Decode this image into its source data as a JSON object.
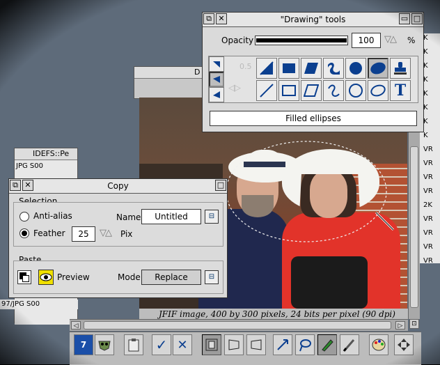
{
  "background": {
    "window_title": "IDEFS::Pe",
    "window_title_short": "D",
    "file_rows": [
      "JPG     S00",
      "",
      "",
      "",
      "",
      "97/JPG    S00"
    ],
    "file_codes_right": [
      "K",
      "K",
      "K",
      "K",
      "K",
      "K",
      "K",
      "K",
      "VR",
      "VR",
      "VR",
      "VR",
      "2K",
      "VR",
      "VR",
      "VR",
      "VR"
    ],
    "image_caption": "JFIF image, 400 by 300 pixels, 24 bits per pixel (90 dpi)"
  },
  "drawing_tools": {
    "title": "\"Drawing\" tools",
    "opacity_label": "Opacity",
    "opacity_value": "100",
    "opacity_unit": "%",
    "opacity_level": 1.0,
    "brush_size": "0.5",
    "status": "Filled ellipses",
    "tools_top": [
      "filled-ramp-icon",
      "filled-rectangle-icon",
      "filled-parallelogram-icon",
      "filled-curve-icon",
      "filled-circle-icon",
      "filled-ellipse-icon",
      "stamp-icon"
    ],
    "tools_bottom": [
      "line-icon",
      "rectangle-outline-icon",
      "parallelogram-outline-icon",
      "curve-outline-icon",
      "circle-outline-icon",
      "ellipse-outline-icon",
      "text-tool-icon"
    ],
    "selected_tool": "filled-ellipse-icon",
    "text_tool_glyph": "T"
  },
  "copy": {
    "title": "Copy",
    "selection_label": "Selection",
    "antialias_label": "Anti-alias",
    "feather_label": "Feather",
    "feather_value": "25",
    "pix_label": "Pix",
    "name_label": "Name",
    "name_value": "Untitled",
    "paste_label": "Paste",
    "preview_label": "Preview",
    "mode_label": "Mode",
    "mode_value": "Replace",
    "selected_radio": "feather"
  },
  "toolbar": {
    "icon_7_glyph": "7",
    "ok_glyph": "✓",
    "cancel_glyph": "✕",
    "items": [
      "info-icon",
      "mask-icon",
      "clipboard-icon",
      "ok-icon",
      "cancel-icon",
      "frame-icon",
      "frame-left-icon",
      "frame-right-icon",
      "move-icon",
      "lasso-icon",
      "pen-icon",
      "brush-icon",
      "palette-icon",
      "scroll-arrows-icon"
    ]
  },
  "colors": {
    "accent_blue": "#0b3f8f",
    "window_grey": "#dadada"
  }
}
